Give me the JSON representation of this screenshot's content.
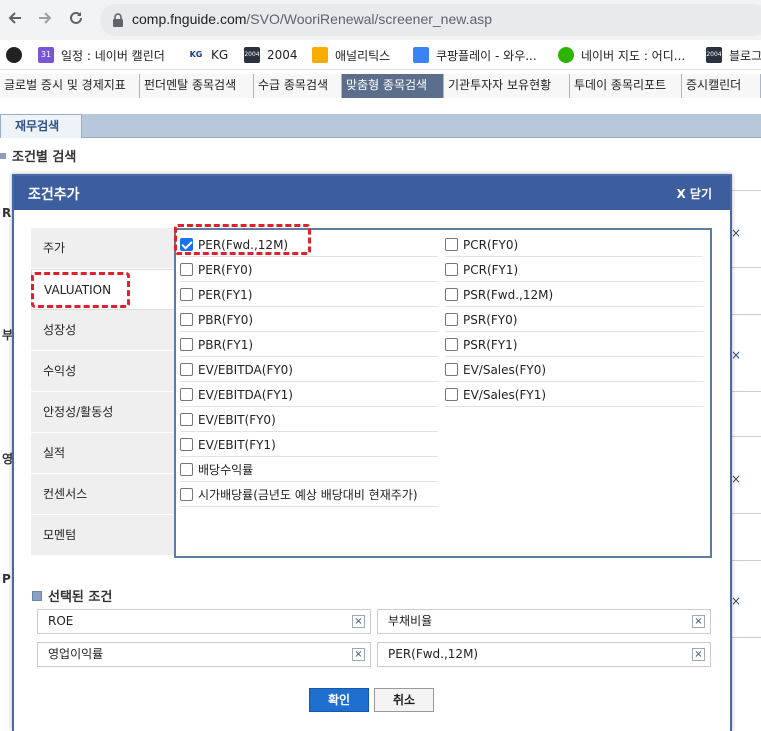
{
  "browser": {
    "url_host": "comp.fnguide.com",
    "url_path": "/SVO/WooriRenewal/screener_new.asp",
    "bookmarks": [
      {
        "label": "",
        "icon": "github-icon"
      },
      {
        "label": "일정 : 네이버 캘린더",
        "icon": "calendar-icon",
        "badge": "31"
      },
      {
        "label": "KG",
        "icon": "kg-logo-icon",
        "badge": "KG"
      },
      {
        "label": "2004",
        "icon": "site-2004-icon",
        "badge": "2004"
      },
      {
        "label": "애널리틱스",
        "icon": "analytics-icon"
      },
      {
        "label": "쿠팡플레이 - 와우...",
        "icon": "coupang-play-icon"
      },
      {
        "label": "네이버 지도 : 어디...",
        "icon": "naver-map-icon"
      },
      {
        "label": "블로그",
        "icon": "site-2004-icon",
        "badge": "2004"
      }
    ]
  },
  "site_nav": {
    "tabs": [
      "글로벌 증시 및 경제지표",
      "펀더멘탈 종목검색",
      "수급 종목검색",
      "맞춤형 종목검색",
      "기관투자자 보유현황",
      "투데이 종목리포트",
      "증시캘린더"
    ],
    "active_index": 3
  },
  "page": {
    "subtab": "재무검색",
    "section_title": "조건별 검색",
    "bg_fragments": [
      "R",
      "부",
      "영",
      "P"
    ]
  },
  "modal": {
    "title": "조건추가",
    "close_label": "X 닫기",
    "categories": [
      "주가",
      "VALUATION",
      "성장성",
      "수익성",
      "안정성/활동성",
      "실적",
      "컨센서스",
      "모멘텀"
    ],
    "active_category": 1,
    "options_left": [
      {
        "label": "PER(Fwd.,12M)",
        "checked": true
      },
      {
        "label": "PER(FY0)",
        "checked": false
      },
      {
        "label": "PER(FY1)",
        "checked": false
      },
      {
        "label": "PBR(FY0)",
        "checked": false
      },
      {
        "label": "PBR(FY1)",
        "checked": false
      },
      {
        "label": "EV/EBITDA(FY0)",
        "checked": false
      },
      {
        "label": "EV/EBITDA(FY1)",
        "checked": false
      },
      {
        "label": "EV/EBIT(FY0)",
        "checked": false
      },
      {
        "label": "EV/EBIT(FY1)",
        "checked": false
      },
      {
        "label": "배당수익률",
        "checked": false
      },
      {
        "label": "시가배당률(금년도 예상 배당대비 현재주가)",
        "checked": false
      }
    ],
    "options_right": [
      {
        "label": "PCR(FY0)",
        "checked": false
      },
      {
        "label": "PCR(FY1)",
        "checked": false
      },
      {
        "label": "PSR(Fwd.,12M)",
        "checked": false
      },
      {
        "label": "PSR(FY0)",
        "checked": false
      },
      {
        "label": "PSR(FY1)",
        "checked": false
      },
      {
        "label": "EV/Sales(FY0)",
        "checked": false
      },
      {
        "label": "EV/Sales(FY1)",
        "checked": false
      }
    ],
    "selected_title": "선택된 조건",
    "selected": [
      "ROE",
      "부채비율",
      "영업이익률",
      "PER(Fwd.,12M)"
    ],
    "remove_glyph": "×",
    "confirm_label": "확인",
    "cancel_label": "취소"
  },
  "colors": {
    "modal_header": "#3d5e9e",
    "highlight": "#e0202a",
    "confirm_button": "#1f6fd1",
    "active_nav_tab": "#5b6f8c"
  }
}
